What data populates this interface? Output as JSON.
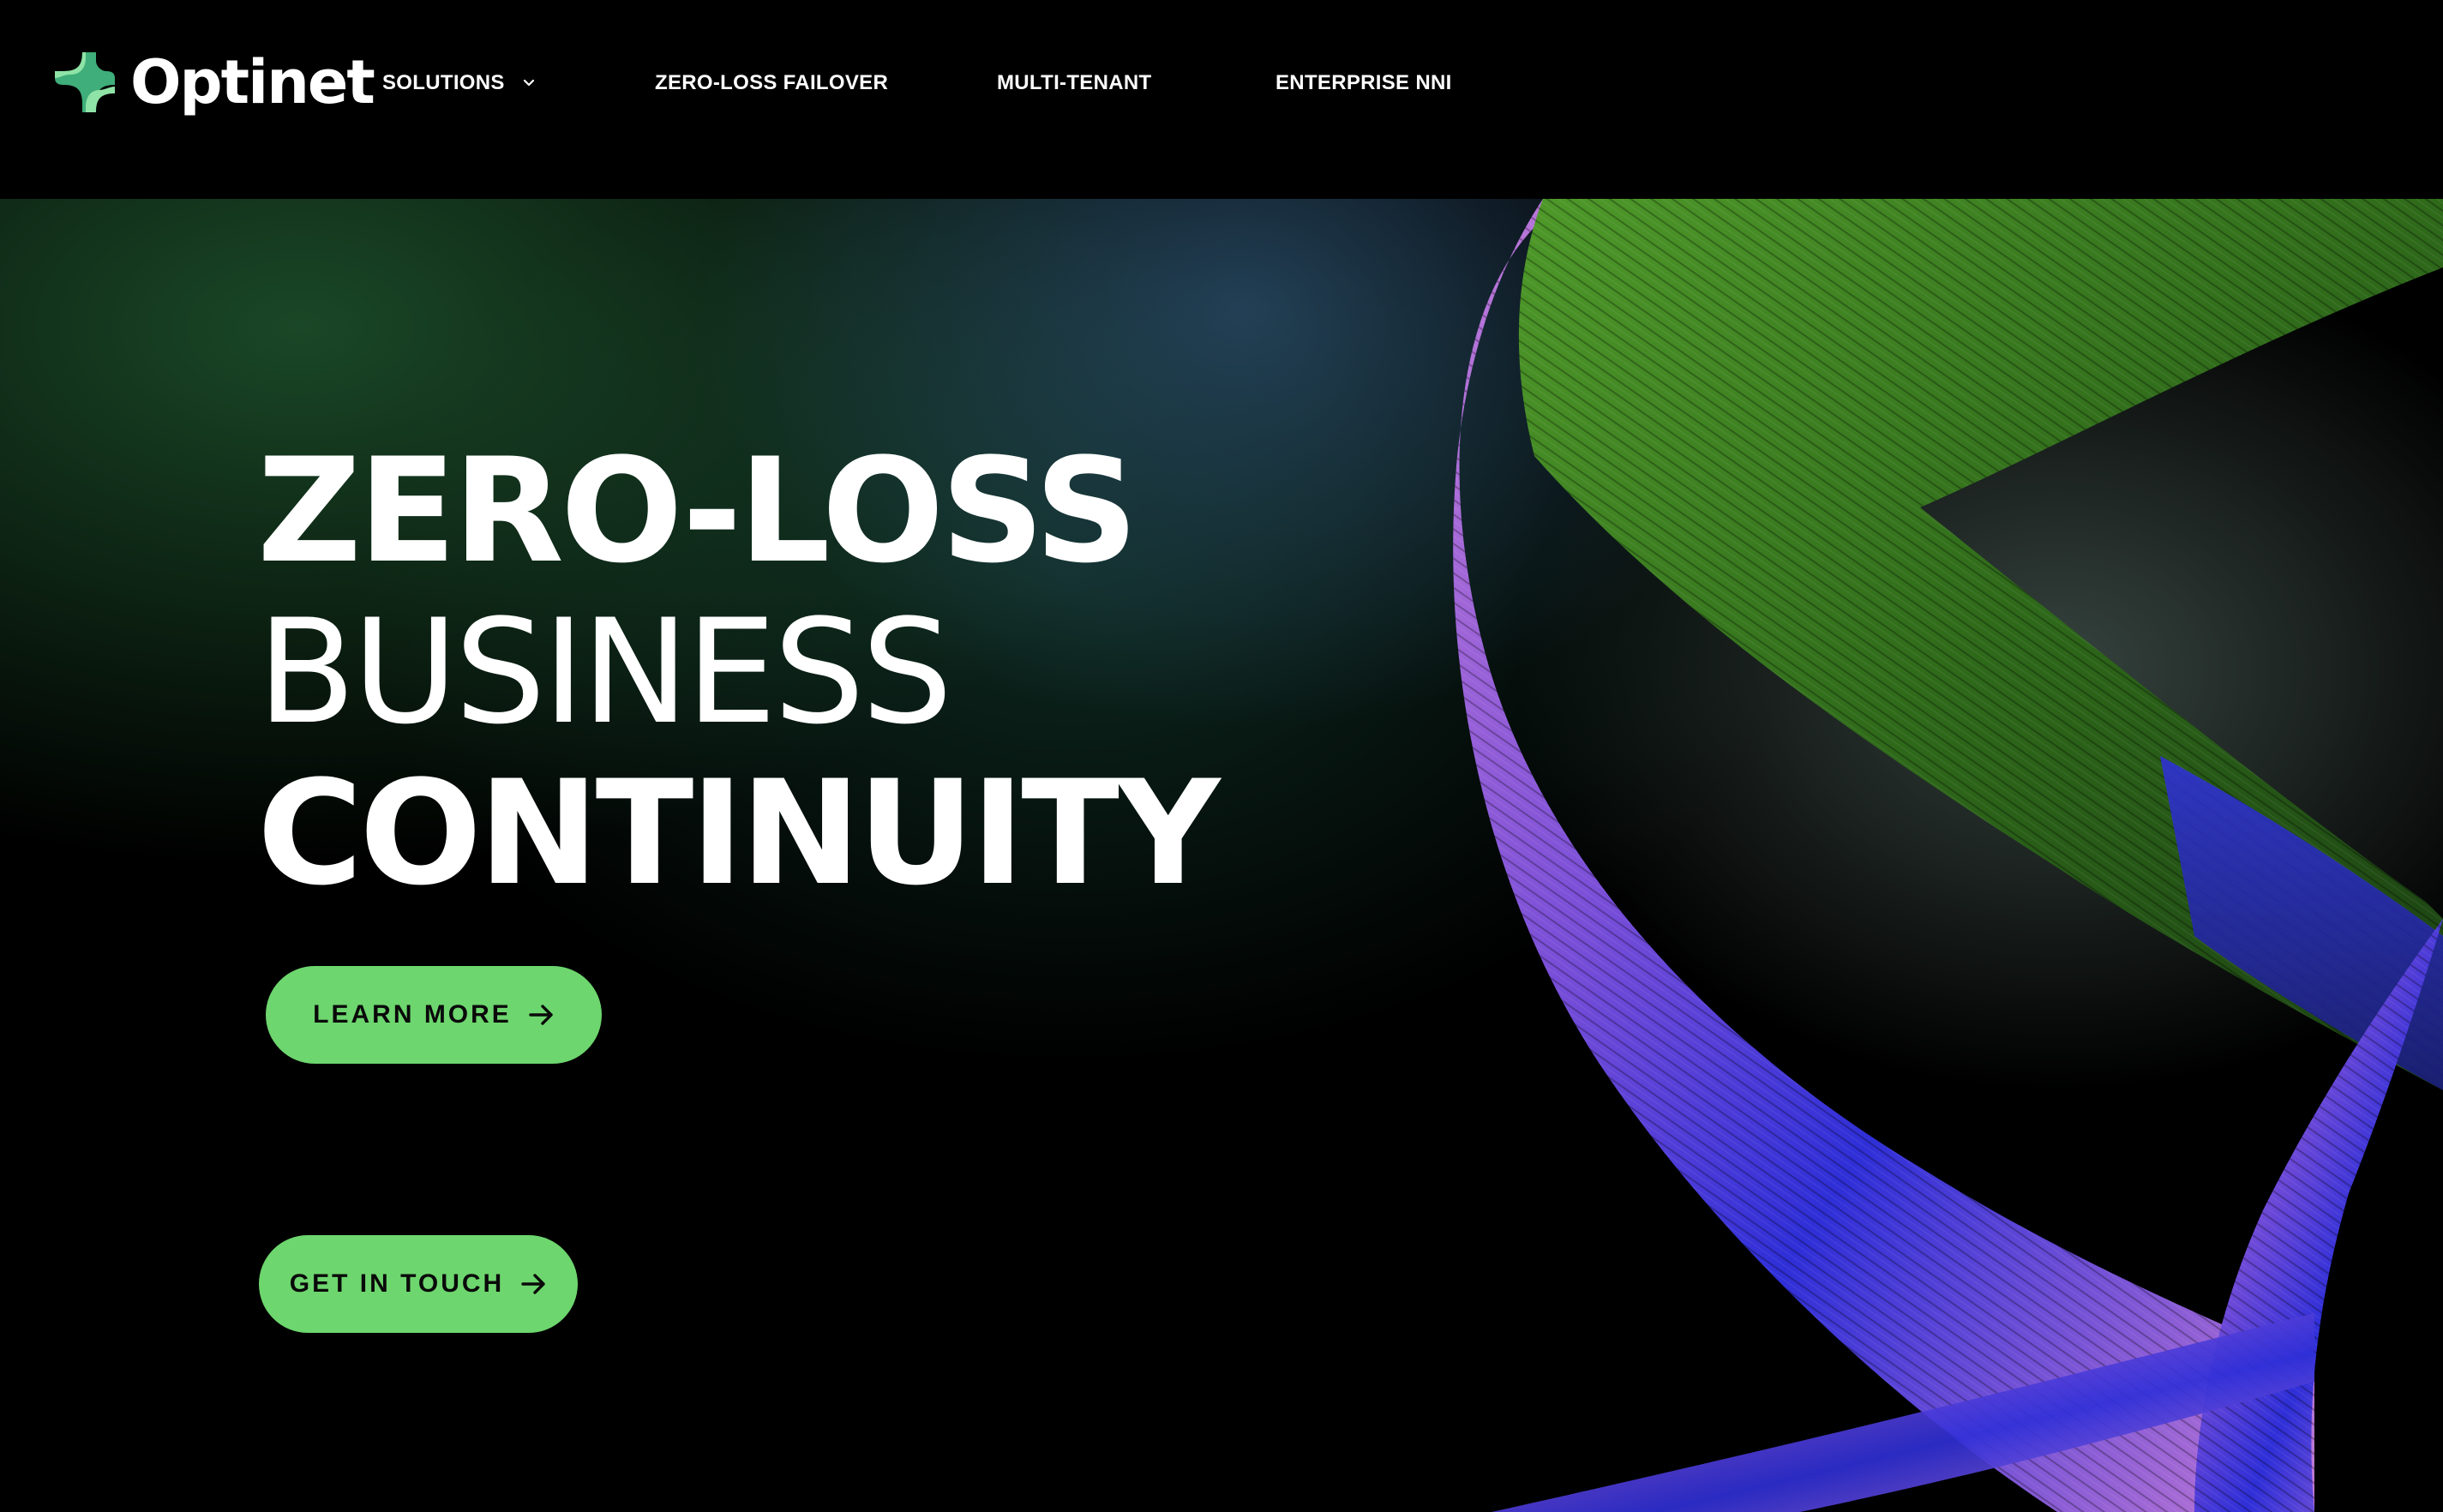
{
  "brand": {
    "name": "Optinet",
    "logo_icon": "optinet-logo-icon",
    "logo_colors": [
      "#8fe3a6",
      "#3fae7a"
    ]
  },
  "nav": {
    "items": [
      {
        "label": "SOLUTIONS",
        "has_dropdown": true,
        "icon": "chevron-down-icon"
      },
      {
        "label": "ZERO-LOSS FAILOVER"
      },
      {
        "label": "MULTI-TENANT"
      },
      {
        "label": "ENTERPRISE NNI"
      }
    ]
  },
  "hero": {
    "headline": {
      "line1": "ZERO-LOSS",
      "line2": "BUSINESS",
      "line3": "CONTINUITY"
    },
    "buttons": [
      {
        "label": "LEARN MORE",
        "icon": "arrow-right-icon"
      },
      {
        "label": "GET IN TOUCH",
        "icon": "arrow-right-icon"
      }
    ],
    "background_image": "twisted-fiber-ribbon-artwork"
  },
  "colors": {
    "page_background": "#000000",
    "accent_button": "#6dd66e",
    "ribbon_green": "#3f7a1f",
    "ribbon_purple": "#b36ad0",
    "ribbon_blue": "#2b2fd6"
  }
}
